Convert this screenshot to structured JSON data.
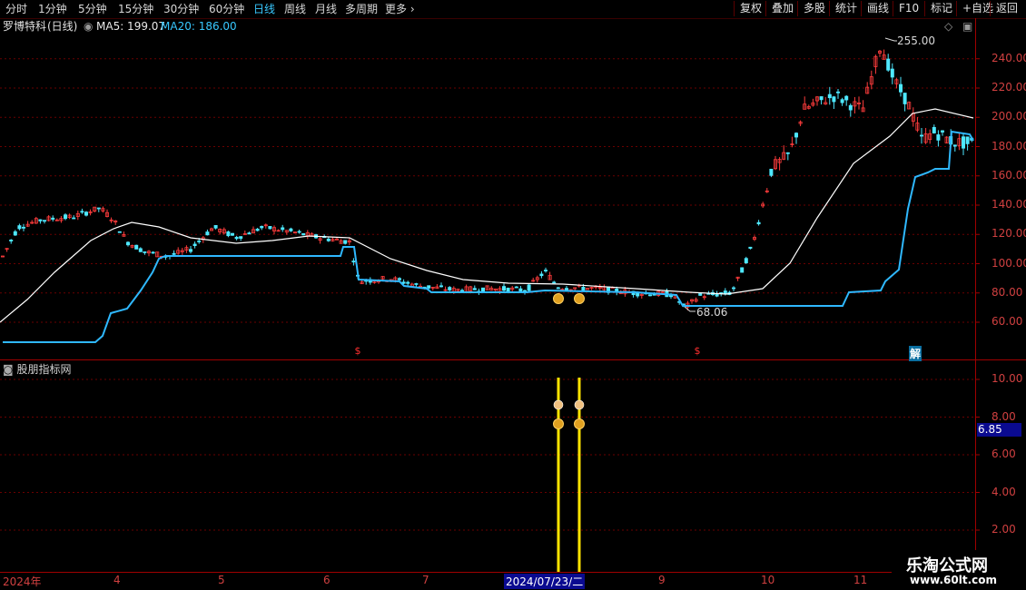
{
  "toolbar": {
    "periods": [
      "分时",
      "1分钟",
      "5分钟",
      "15分钟",
      "30分钟",
      "60分钟",
      "日线",
      "周线",
      "月线",
      "多周期",
      "更多"
    ],
    "active_period": "日线",
    "right_buttons": [
      "复权",
      "叠加",
      "多股",
      "统计",
      "画线",
      "F10",
      "标记",
      "+自选",
      "返回"
    ]
  },
  "stock": {
    "name": "罗博特科",
    "period": "(日线)"
  },
  "ma": {
    "ma5_label": "MA5: 199.07",
    "ma20_label": "MA20: 186.00"
  },
  "indicator": {
    "name": "股朋指标网",
    "current_value": "6.85"
  },
  "annotations": {
    "high": "255.00",
    "low": "68.06",
    "jie": "解"
  },
  "cursor_date": "2024/07/23/二",
  "watermark": {
    "title": "乐淘公式网",
    "url": "www.60lt.com"
  },
  "colors": {
    "up": "#ff3c3c",
    "down": "#4ee8ff",
    "ma5": "#ffffff",
    "trail": "#2fb8ff",
    "signal": "#ffe400",
    "grid": "#6a0000"
  },
  "chart_data": [
    {
      "type": "candlestick",
      "title": "罗博特科 (日线)",
      "x": [
        "2024年",
        "4",
        "5",
        "6",
        "7",
        "2024/07/23/二",
        "9",
        "10",
        "11"
      ],
      "ylim": [
        50,
        265
      ],
      "yticks": [
        60,
        80,
        100,
        120,
        140,
        160,
        180,
        200,
        220,
        240
      ],
      "grid": true,
      "series": [
        {
          "name": "MA5",
          "values": [
            199.07
          ]
        },
        {
          "name": "MA20",
          "values": [
            186.0
          ]
        }
      ],
      "annotations": {
        "high": 255.0,
        "low": 68.06
      }
    },
    {
      "type": "bar",
      "title": "股朋指标网",
      "ylim": [
        0.5,
        11
      ],
      "yticks": [
        2,
        4,
        6,
        8,
        10
      ],
      "current": 6.85
    }
  ]
}
